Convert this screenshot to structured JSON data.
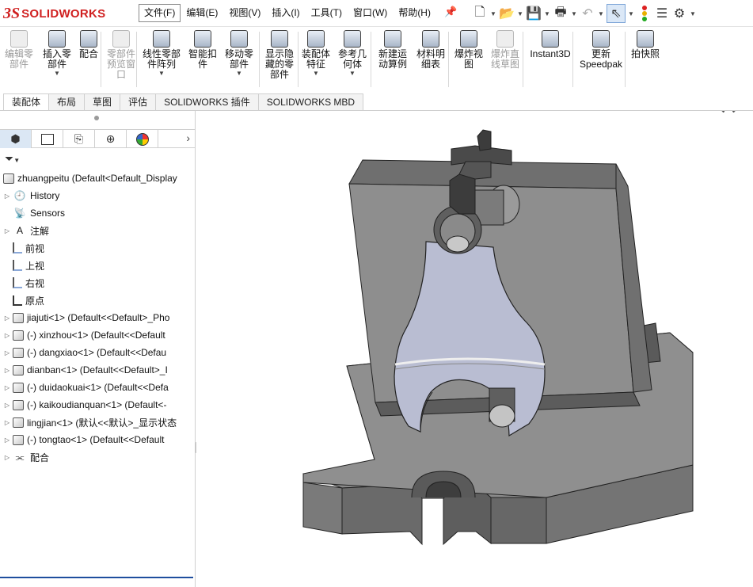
{
  "app": {
    "brand_prefix": "3S",
    "brand_name": "SOLIDWORKS"
  },
  "menu": [
    {
      "label": "文件(F)",
      "active": true
    },
    {
      "label": "编辑(E)"
    },
    {
      "label": "视图(V)"
    },
    {
      "label": "插入(I)"
    },
    {
      "label": "工具(T)"
    },
    {
      "label": "窗口(W)"
    },
    {
      "label": "帮助(H)"
    }
  ],
  "quick_access": [
    "new-document-icon",
    "open-icon",
    "save-icon",
    "print-icon",
    "undo-icon",
    "select-icon",
    "rebuild-icon",
    "file-properties-icon",
    "options-icon"
  ],
  "ribbon": [
    {
      "label": "编辑零\n部件",
      "disabled": true
    },
    {
      "label": "插入零\n部件",
      "dropdown": true
    },
    {
      "label": "配合"
    },
    {
      "label": "零部件\n预览窗\n口",
      "disabled": true
    },
    {
      "label": "线性零部\n件阵列",
      "dropdown": true
    },
    {
      "label": "智能扣\n件"
    },
    {
      "label": "移动零\n部件",
      "dropdown": true
    },
    {
      "label": "显示隐\n藏的零\n部件"
    },
    {
      "label": "装配体\n特征",
      "dropdown": true
    },
    {
      "label": "参考几\n何体",
      "dropdown": true
    },
    {
      "label": "新建运\n动算例"
    },
    {
      "label": "材料明\n细表"
    },
    {
      "label": "爆炸视\n图"
    },
    {
      "label": "爆炸直\n线草图",
      "disabled": true
    },
    {
      "label": "Instant3D"
    },
    {
      "label": "更新\nSpeedpak"
    },
    {
      "label": "拍快照"
    }
  ],
  "command_tabs": [
    {
      "label": "装配体",
      "active": true
    },
    {
      "label": "布局"
    },
    {
      "label": "草图"
    },
    {
      "label": "评估"
    },
    {
      "label": "SOLIDWORKS 插件"
    },
    {
      "label": "SOLIDWORKS MBD"
    }
  ],
  "panel_tabs": [
    "featuremanager-icon",
    "propertymanager-icon",
    "configurationmanager-icon",
    "dimxpertmanager-icon",
    "displaymanager-icon"
  ],
  "tree": {
    "root": "zhuangpeitu  (Default<Default_Display",
    "items": [
      {
        "label": "History",
        "icon": "history-icon",
        "expandable": true
      },
      {
        "label": "Sensors",
        "icon": "sensors-icon",
        "expandable": false
      },
      {
        "label": "注解",
        "icon": "annotations-icon",
        "expandable": true
      },
      {
        "label": "前视",
        "icon": "plane-icon",
        "expandable": false
      },
      {
        "label": "上视",
        "icon": "plane-icon",
        "expandable": false
      },
      {
        "label": "右视",
        "icon": "plane-icon",
        "expandable": false
      },
      {
        "label": "原点",
        "icon": "origin-icon",
        "expandable": false
      },
      {
        "label": "jiajuti<1> (Default<<Default>_Pho",
        "icon": "part-icon",
        "expandable": true
      },
      {
        "label": "(-) xinzhou<1> (Default<<Default",
        "icon": "part-icon",
        "expandable": true
      },
      {
        "label": "(-) dangxiao<1> (Default<<Defau",
        "icon": "part-icon",
        "expandable": true
      },
      {
        "label": "dianban<1> (Default<<Default>_I",
        "icon": "part-icon",
        "expandable": true
      },
      {
        "label": "(-) duidaokuai<1> (Default<<Defa",
        "icon": "part-icon",
        "expandable": true
      },
      {
        "label": "(-) kaikoudianquan<1> (Default<-",
        "icon": "part-icon",
        "expandable": true
      },
      {
        "label": "lingjian<1> (默认<<默认>_显示状态",
        "icon": "part-icon",
        "expandable": true
      },
      {
        "label": "(-) tongtao<1> (Default<<Default",
        "icon": "part-icon",
        "expandable": true
      },
      {
        "label": "配合",
        "icon": "mates-icon",
        "expandable": true
      }
    ]
  },
  "colors": {
    "brand": "#d02020",
    "selection": "#1f4e9e",
    "model_dark": "#6e6e6e",
    "model_face": "#9a9a9a",
    "model_part": "#b9bdd2"
  }
}
